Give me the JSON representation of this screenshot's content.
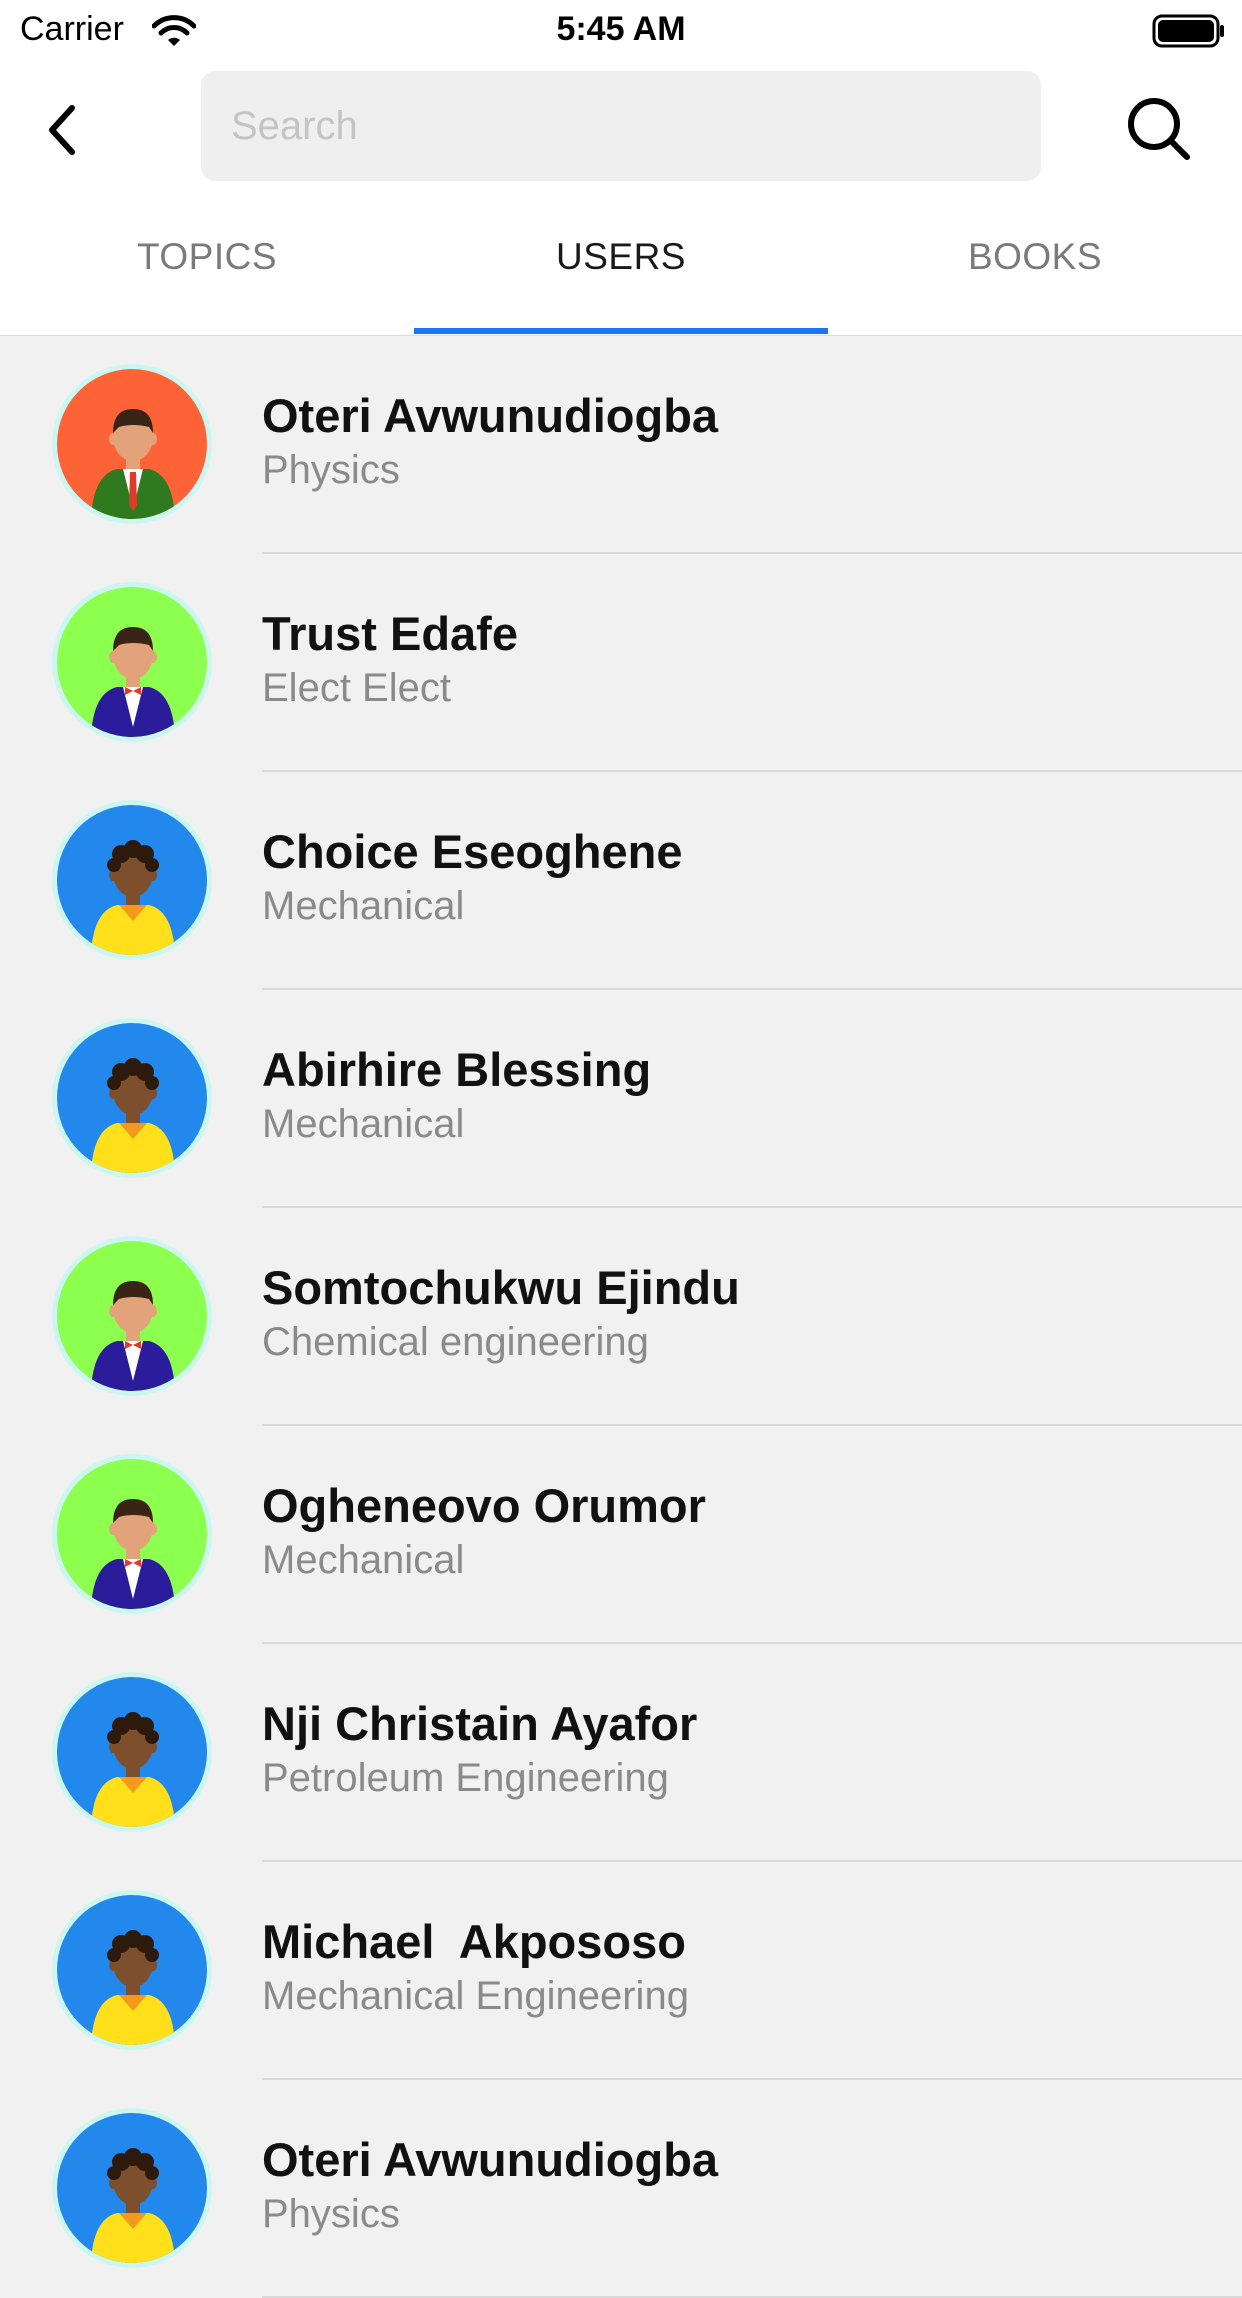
{
  "status_bar": {
    "carrier": "Carrier",
    "time": "5:45 AM",
    "wifi_icon": "wifi-icon",
    "battery_icon": "battery-icon"
  },
  "nav": {
    "back_icon": "chevron-left-icon",
    "search_placeholder": "Search",
    "search_value": "",
    "search_icon": "search-icon"
  },
  "tabs": [
    {
      "label": "TOPICS",
      "active": false
    },
    {
      "label": "USERS",
      "active": true
    },
    {
      "label": "BOOKS",
      "active": false
    }
  ],
  "colors": {
    "accent": "#1e74f2",
    "avatar_orange": "#fe6338",
    "avatar_green": "#8dff4f",
    "avatar_blue": "#2388ec"
  },
  "users": [
    {
      "name": "Oteri Avwunudiogba",
      "department": "Physics",
      "avatar": "orange"
    },
    {
      "name": "Trust Edafe",
      "department": "Elect Elect",
      "avatar": "green"
    },
    {
      "name": "Choice Eseoghene",
      "department": "Mechanical",
      "avatar": "blue"
    },
    {
      "name": "Abirhire Blessing",
      "department": "Mechanical",
      "avatar": "blue"
    },
    {
      "name": "Somtochukwu Ejindu",
      "department": "Chemical engineering",
      "avatar": "green"
    },
    {
      "name": "Ogheneovo Orumor",
      "department": "Mechanical",
      "avatar": "green"
    },
    {
      "name": "Nji Christain Ayafor",
      "department": "Petroleum Engineering",
      "avatar": "blue"
    },
    {
      "name": "Michael  Akpososo",
      "department": "Mechanical Engineering",
      "avatar": "blue"
    },
    {
      "name": "Oteri Avwunudiogba",
      "department": "Physics",
      "avatar": "blue"
    }
  ]
}
